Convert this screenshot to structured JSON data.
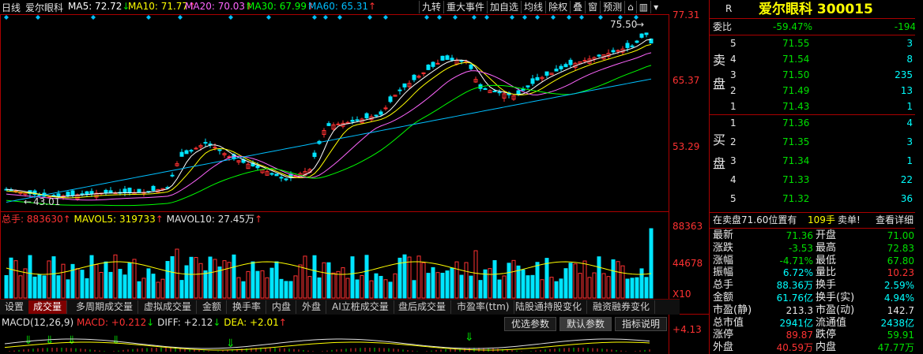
{
  "header": {
    "period": "日线",
    "stock_name": "爱尔眼科",
    "ma": [
      {
        "label": "MA5: 72.72",
        "arrow": "↓",
        "color": "#ffffff"
      },
      {
        "label": "MA10: 71.77",
        "arrow": "↑",
        "color": "#ffff00"
      },
      {
        "label": "MA20: 70.03",
        "arrow": "↑",
        "color": "#ff66ff"
      },
      {
        "label": "MA30: 67.99",
        "arrow": "↑",
        "color": "#00ff00"
      },
      {
        "label": "MA60: 65.31",
        "arrow": "↑",
        "color": "#00bfff"
      }
    ],
    "tools": [
      "九转",
      "重大事件",
      "加自选",
      "均线",
      "除权",
      "叠",
      "窗",
      "预测"
    ]
  },
  "price_axis": [
    "77.31",
    "65.37",
    "53.29"
  ],
  "price_annotations": {
    "high": "75.50",
    "low": "43.01"
  },
  "volume": {
    "label_total": "总手: 883630",
    "label_mavol5": "MAVOL5: 319733",
    "label_mavol10": "MAVOL10: 27.45万",
    "axis": [
      "88363",
      "44678"
    ],
    "unit": "X10"
  },
  "tabs": [
    "设置",
    "成交量",
    "多周期成交量",
    "虚拟成交量",
    "金额",
    "换手率",
    "内盘",
    "外盘",
    "AI立桩成交量",
    "盘后成交量",
    "市盈率(ttm)",
    "陆股通持股变化",
    "融资融券变化"
  ],
  "macd": {
    "label": "MACD(12,26,9)",
    "macd_val": "MACD: +0.212",
    "diff_val": "DIFF: +2.12",
    "dea_val": "DEA: +2.01",
    "axis_top": "4.13",
    "buttons": [
      "优选参数",
      "默认参数",
      "指标说明"
    ]
  },
  "quote": {
    "r_label": "R",
    "title": "爱尔眼科 300015",
    "weibi_label": "委比",
    "weibi_pct": "-59.47%",
    "weibi_diff": "-194",
    "sell_label": "卖盘",
    "buy_label": "买盘",
    "sells": [
      {
        "n": "5",
        "price": "71.55",
        "vol": "3"
      },
      {
        "n": "4",
        "price": "71.54",
        "vol": "8"
      },
      {
        "n": "3",
        "price": "71.50",
        "vol": "235"
      },
      {
        "n": "2",
        "price": "71.49",
        "vol": "13"
      },
      {
        "n": "1",
        "price": "71.43",
        "vol": "1"
      }
    ],
    "buys": [
      {
        "n": "1",
        "price": "71.36",
        "vol": "4"
      },
      {
        "n": "2",
        "price": "71.35",
        "vol": "3"
      },
      {
        "n": "3",
        "price": "71.34",
        "vol": "1"
      },
      {
        "n": "4",
        "price": "71.33",
        "vol": "22"
      },
      {
        "n": "5",
        "price": "71.32",
        "vol": "36"
      }
    ],
    "notice": "在卖盘71.60位置有",
    "notice_vol": "109手",
    "notice_sell": "卖单!",
    "notice_link": "查看详细",
    "stats": [
      {
        "l1": "最新",
        "v1": "71.36",
        "c1": "green",
        "l2": "开盘",
        "v2": "71.00",
        "c2": "green"
      },
      {
        "l1": "涨跌",
        "v1": "-3.53",
        "c1": "green",
        "l2": "最高",
        "v2": "72.83",
        "c2": "green"
      },
      {
        "l1": "涨幅",
        "v1": "-4.71%",
        "c1": "green",
        "l2": "最低",
        "v2": "67.80",
        "c2": "green"
      },
      {
        "l1": "振幅",
        "v1": "6.72%",
        "c1": "cyan",
        "l2": "量比",
        "v2": "10.23",
        "c2": "red"
      },
      {
        "l1": "总手",
        "v1": "88.36万",
        "c1": "cyan",
        "l2": "换手",
        "v2": "2.59%",
        "c2": "cyan"
      },
      {
        "l1": "金额",
        "v1": "61.76亿",
        "c1": "cyan",
        "l2": "换手(实)",
        "v2": "4.94%",
        "c2": "cyan"
      },
      {
        "l1": "市盈(静)",
        "v1": "213.3",
        "c1": "white",
        "l2": "市盈(动)",
        "v2": "142.7",
        "c2": "white"
      },
      {
        "l1": "总市值",
        "v1": "2941亿",
        "c1": "cyan",
        "l2": "流通值",
        "v2": "2438亿",
        "c2": "cyan"
      },
      {
        "l1": "涨停",
        "v1": "89.87",
        "c1": "red",
        "l2": "跌停",
        "v2": "59.91",
        "c2": "green"
      },
      {
        "l1": "外盘",
        "v1": "40.59万",
        "c1": "red",
        "l2": "内盘",
        "v2": "47.77万",
        "c2": "green"
      }
    ]
  },
  "colors": {
    "up": "#ff3232",
    "down": "#00e5ff",
    "frame": "#aa0000"
  }
}
